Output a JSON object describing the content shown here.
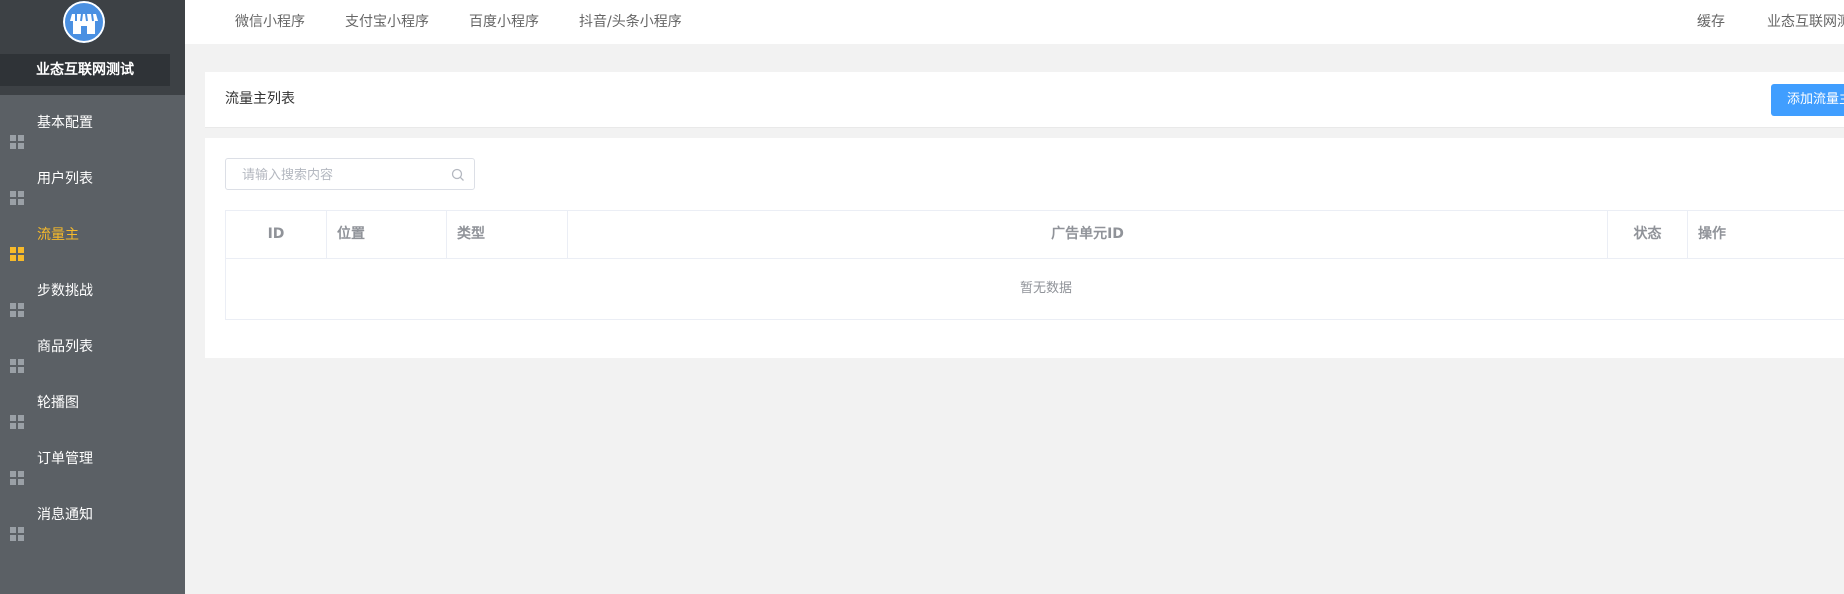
{
  "sidebar": {
    "brand": "业态互联网测试",
    "items": [
      {
        "label": "基本配置",
        "icon": "grid-icon",
        "active": false
      },
      {
        "label": "用户列表",
        "icon": "grid-icon",
        "active": false
      },
      {
        "label": "流量主",
        "icon": "grid-icon",
        "active": true
      },
      {
        "label": "步数挑战",
        "icon": "grid-icon",
        "active": false
      },
      {
        "label": "商品列表",
        "icon": "grid-icon",
        "active": false
      },
      {
        "label": "轮播图",
        "icon": "grid-icon",
        "active": false
      },
      {
        "label": "订单管理",
        "icon": "grid-icon",
        "active": false
      },
      {
        "label": "消息通知",
        "icon": "grid-icon",
        "active": false
      }
    ]
  },
  "topnav": {
    "tabs": [
      "微信小程序",
      "支付宝小程序",
      "百度小程序",
      "抖音/头条小程序"
    ],
    "cache": "缓存",
    "user": "业态互联网测试"
  },
  "page": {
    "title": "流量主列表",
    "add_button": "添加流量主"
  },
  "search": {
    "placeholder": "请输入搜索内容",
    "value": ""
  },
  "table": {
    "columns": [
      "ID",
      "位置",
      "类型",
      "广告单元ID",
      "状态",
      "操作"
    ],
    "rows": [],
    "empty_text": "暂无数据"
  },
  "colors": {
    "sidebar_bg": "#5b6065",
    "brand_bg": "#3d4145",
    "active": "#f7ba2a",
    "primary": "#409eff",
    "background": "#f2f2f2"
  }
}
